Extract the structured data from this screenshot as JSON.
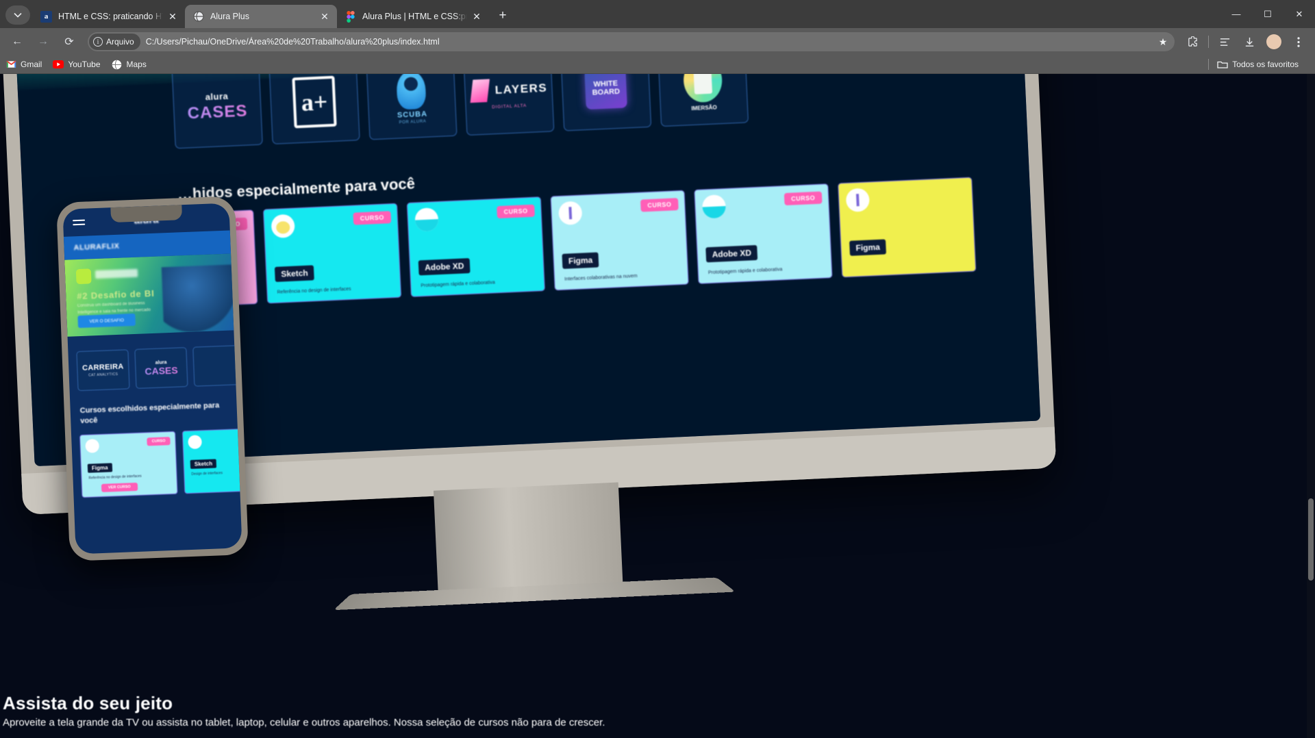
{
  "browser": {
    "tabs": [
      {
        "favicon": "alura-icon",
        "title": "HTML e CSS: praticando HTML/",
        "active": false
      },
      {
        "favicon": "globe-icon",
        "title": "Alura Plus",
        "active": true
      },
      {
        "favicon": "figma-icon",
        "title": "Alura Plus | HTML e CSS:praticar",
        "active": false
      }
    ],
    "new_tab_label": "+",
    "window_controls": {
      "minimize": "—",
      "maximize": "☐",
      "close": "✕"
    },
    "nav": {
      "back": "←",
      "forward": "→",
      "reload": "⟳"
    },
    "omnibox": {
      "file_label": "Arquivo",
      "info_glyph": "i",
      "url": "C:/Users/Pichau/OneDrive/Área%20de%20Trabalho/alura%20plus/index.html",
      "star": "★"
    },
    "toolbar_icons": [
      "extensions-icon",
      "reading-list-icon",
      "downloads-icon",
      "profile-avatar-icon",
      "more-menu-icon"
    ],
    "bookmarks": [
      {
        "icon": "gmail-icon",
        "label": "Gmail"
      },
      {
        "icon": "youtube-icon",
        "label": "YouTube"
      },
      {
        "icon": "maps-icon",
        "label": "Maps"
      }
    ],
    "bookmarks_right": {
      "icon": "folder-icon",
      "label": "Todos os favoritos"
    }
  },
  "page": {
    "desktop": {
      "section_title": "…hidos especialmente para você",
      "logo_cards": [
        {
          "name": "alura-cases-logo",
          "top": "alura",
          "bottom": "CASES"
        },
        {
          "name": "alura-plus-logo",
          "mark": "a+"
        },
        {
          "name": "scuba-logo",
          "text": "SCUBA",
          "sub": "POR ALURA"
        },
        {
          "name": "layers-logo",
          "text": "LAYERS",
          "sub": "DIGITAL ALTA"
        },
        {
          "name": "white-bread-logo",
          "text": "WHITE BOARD"
        },
        {
          "name": "imersao-logo",
          "text": "IMERSÃO"
        }
      ],
      "course_cards": [
        {
          "color": "pink",
          "badge": "CURSO",
          "label": "",
          "sub": ""
        },
        {
          "color": "cyan",
          "badge": "CURSO",
          "label": "Sketch",
          "sub": "Referência no design de interfaces"
        },
        {
          "color": "cyan",
          "badge": "CURSO",
          "label": "Adobe XD",
          "sub": "Prototipagem rápida e colaborativa"
        },
        {
          "color": "lcyan",
          "badge": "CURSO",
          "label": "Figma",
          "sub": "Interfaces colaborativas na nuvem"
        },
        {
          "color": "lcyan",
          "badge": "CURSO",
          "label": "Adobe XD",
          "sub": "Prototipagem rápida e colaborativa"
        },
        {
          "color": "yellow",
          "badge": "",
          "label": "Figma",
          "sub": ""
        }
      ]
    },
    "phone": {
      "logo": "alura",
      "brand": "ALURAFLIX",
      "banner": {
        "title": "#2 Desafio de BI",
        "desc": "Construa um dashboard de Business Intelligence e saia na frente no mercado",
        "button": "VER O DESAFIO"
      },
      "categories": [
        {
          "title": "CARREIRA",
          "sub": "CAT ANALYTICS"
        },
        {
          "top": "alura",
          "bottom": "CASES"
        }
      ],
      "section_title": "Cursos escolhidos especialmente para você",
      "courses": [
        {
          "color": "lcyan",
          "badge": "CURSO",
          "label": "Figma",
          "sub": "Referência no design de interfaces",
          "button": "VER CURSO"
        },
        {
          "color": "cyan",
          "badge": "",
          "label": "Sketch",
          "sub": "Design de interfaces",
          "button": ""
        }
      ]
    },
    "bottom": {
      "title": "Assista do seu jeito",
      "subtitle": "Aproveite a tela grande da TV ou assista no tablet, laptop, celular e outros aparelhos. Nossa seleção de cursos não para de crescer."
    }
  }
}
